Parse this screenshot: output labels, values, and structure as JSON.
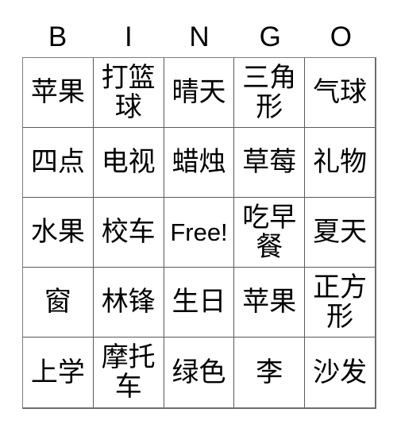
{
  "card": {
    "type": "bingo-card",
    "columns": 5,
    "rows": 5,
    "header": {
      "letters": [
        "B",
        "I",
        "N",
        "G",
        "O"
      ]
    },
    "grid": [
      [
        {
          "text": "苹果",
          "free": false
        },
        {
          "text": "打篮球",
          "free": false
        },
        {
          "text": "晴天",
          "free": false
        },
        {
          "text": "三角形",
          "free": false
        },
        {
          "text": "气球",
          "free": false
        }
      ],
      [
        {
          "text": "四点",
          "free": false
        },
        {
          "text": "电视",
          "free": false
        },
        {
          "text": "蜡烛",
          "free": false
        },
        {
          "text": "草莓",
          "free": false
        },
        {
          "text": "礼物",
          "free": false
        }
      ],
      [
        {
          "text": "水果",
          "free": false
        },
        {
          "text": "校车",
          "free": false
        },
        {
          "text": "Free!",
          "free": true
        },
        {
          "text": "吃早餐",
          "free": false
        },
        {
          "text": "夏天",
          "free": false
        }
      ],
      [
        {
          "text": "窗",
          "free": false
        },
        {
          "text": "林锋",
          "free": false
        },
        {
          "text": "生日",
          "free": false
        },
        {
          "text": "苹果",
          "free": false
        },
        {
          "text": "正方形",
          "free": false
        }
      ],
      [
        {
          "text": "上学",
          "free": false
        },
        {
          "text": "摩托车",
          "free": false
        },
        {
          "text": "绿色",
          "free": false
        },
        {
          "text": "李",
          "free": false
        },
        {
          "text": "沙发",
          "free": false
        }
      ]
    ],
    "colors": {
      "background": "#ffffff",
      "text": "#000000",
      "grid_line": "#5a5a5a",
      "outer_border": "#6e6e6e"
    }
  }
}
